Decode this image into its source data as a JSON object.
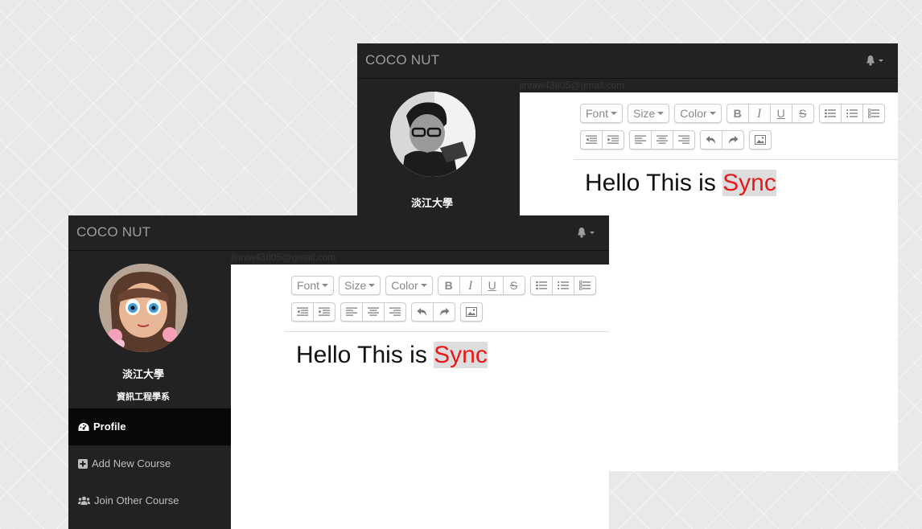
{
  "windows": [
    {
      "id": "back",
      "brand": "COCO NUT",
      "email": "jinniw43805@gmail.com",
      "user_name": "淡江大學",
      "department": "",
      "toolbar": {
        "font": "Font",
        "size": "Size",
        "color": "Color",
        "bold": "B",
        "italic": "I",
        "underline": "U",
        "strike": "S"
      },
      "editor": {
        "text": "Hello This is ",
        "highlight": "Sync"
      }
    },
    {
      "id": "front",
      "brand": "COCO NUT",
      "email": "jinniw43805@gmail.com",
      "user_name": "淡江大學",
      "department": "資訊工程學系",
      "menu": [
        {
          "label": "Profile",
          "icon": "dashboard-icon",
          "active": true
        },
        {
          "label": "Add New Course",
          "icon": "plus-square-icon",
          "active": false
        },
        {
          "label": "Join Other Course",
          "icon": "users-icon",
          "active": false
        }
      ],
      "toolbar": {
        "font": "Font",
        "size": "Size",
        "color": "Color",
        "bold": "B",
        "italic": "I",
        "underline": "U",
        "strike": "S"
      },
      "editor": {
        "text": "Hello This is ",
        "highlight": "Sync"
      }
    }
  ],
  "colors": {
    "navbar": "#222222",
    "active_menu": "#080808",
    "highlight_text": "#e61a1a",
    "highlight_bg": "#dddddd"
  }
}
